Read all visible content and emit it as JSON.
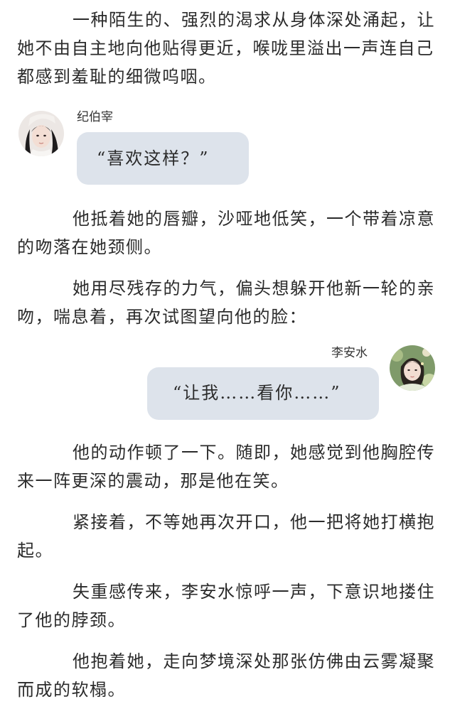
{
  "paragraphs": [
    "一种陌生的、强烈的渴求从身体深处涌起，让她不由自主地向他贴得更近，喉咙里溢出一声连自己都感到羞耻的细微呜咽。",
    "他抵着她的唇瓣，沙哑地低笑，一个带着凉意的吻落在她颈侧。",
    "她用尽残存的力气，偏头想躲开他新一轮的亲吻，喘息着，再次试图望向他的脸：",
    "他的动作顿了一下。随即，她感觉到他胸腔传来一阵更深的震动，那是他在笑。",
    "紧接着，不等她再次开口，他一把将她打横抱起。",
    "失重感传来，李安水惊呼一声，下意识地搂住了他的脖颈。",
    "他抱着她，走向梦境深处那张仿佛由云雾凝聚而成的软榻。"
  ],
  "dialogues": [
    {
      "speaker": "纪伯宰",
      "text": "“喜欢这样？”",
      "side": "left",
      "avatar_icon": "male-character-avatar"
    },
    {
      "speaker": "李安水",
      "text": "“让我……看你……”",
      "side": "right",
      "avatar_icon": "female-character-avatar"
    }
  ],
  "colors": {
    "bubble": "#dde3eb",
    "text": "#2b2b2b"
  }
}
